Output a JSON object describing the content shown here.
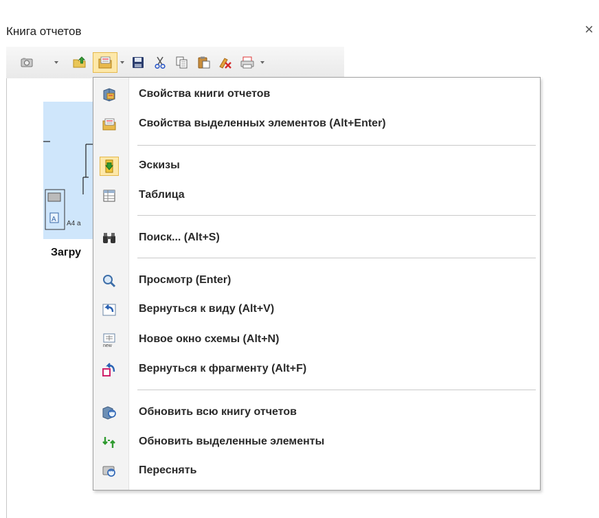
{
  "window": {
    "title": "Книга отчетов",
    "close_glyph": "×"
  },
  "toolbar": {
    "buttons": [
      {
        "icon": "camera-icon",
        "dropdown": true
      },
      {
        "icon": "folder-up-icon",
        "dropdown": false
      },
      {
        "icon": "properties-icon",
        "dropdown": true,
        "active": true
      },
      {
        "icon": "save-icon",
        "dropdown": false
      },
      {
        "icon": "cut-icon",
        "dropdown": false
      },
      {
        "icon": "copy-icon",
        "dropdown": false
      },
      {
        "icon": "paste-icon",
        "dropdown": false
      },
      {
        "icon": "delete-icon",
        "dropdown": false
      },
      {
        "icon": "print-setup-icon",
        "dropdown": true
      }
    ]
  },
  "panel": {
    "thumbnail_caption": "Загру",
    "paper_label": "A4 a"
  },
  "menu": {
    "items": [
      {
        "label": "Свойства книги отчетов",
        "icon": "book-properties-icon"
      },
      {
        "label": "Свойства выделенных элементов (Alt+Enter)",
        "icon": "element-properties-icon"
      },
      {
        "label": "Эскизы",
        "icon": "thumbnails-icon",
        "selected": true
      },
      {
        "label": "Таблица",
        "icon": "table-icon"
      },
      {
        "label": "Поиск... (Alt+S)",
        "icon": "binoculars-icon"
      },
      {
        "label": "Просмотр (Enter)",
        "icon": "magnifier-icon"
      },
      {
        "label": "Вернуться к виду (Alt+V)",
        "icon": "back-to-view-icon"
      },
      {
        "label": "Новое окно схемы (Alt+N)",
        "icon": "new-window-icon"
      },
      {
        "label": "Вернуться к фрагменту (Alt+F)",
        "icon": "back-to-fragment-icon"
      },
      {
        "label": "Обновить всю книгу отчетов",
        "icon": "refresh-book-icon"
      },
      {
        "label": "Обновить выделенные элементы",
        "icon": "refresh-selected-icon"
      },
      {
        "label": "Переснять",
        "icon": "retake-icon"
      }
    ]
  }
}
